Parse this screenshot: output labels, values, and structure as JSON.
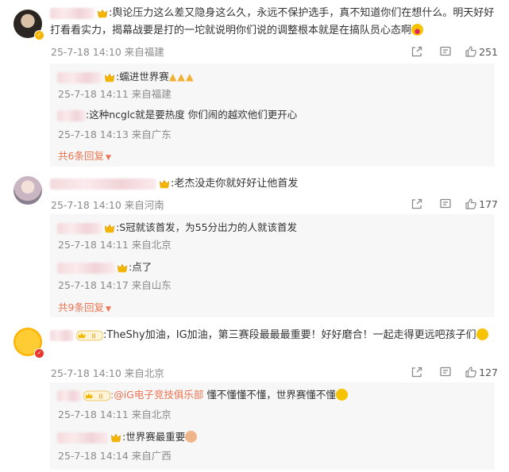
{
  "comments": [
    {
      "text": ":舆论压力这么差又隐身这么久，永远不保护选手，真不知道你们在想什么。明天好好打看看实力，揭幕战要是打的一坨就说明你们说的调整根本就是在搞队员心态啊",
      "time": "25-7-18 14:10",
      "location": "来自福建",
      "likes": "251",
      "replies": [
        {
          "text": ":蠕进世界赛",
          "time": "25-7-18 14:11",
          "location": "来自福建"
        },
        {
          "text": ":这种ncglc就是要热度 你们闹的越欢他们更开心",
          "time": "25-7-18 14:13",
          "location": "来自广东"
        }
      ],
      "more": "共6条回复"
    },
    {
      "text": ":老杰没走你就好好让他首发",
      "time": "25-7-18 14:10",
      "location": "来自河南",
      "likes": "177",
      "replies": [
        {
          "text": ":S冠就该首发，为55分出力的人就该首发",
          "time": "25-7-18 14:11",
          "location": "来自北京"
        },
        {
          "text": ":点了",
          "time": "25-7-18 14:17",
          "location": "来自山东"
        }
      ],
      "more": "共9条回复"
    },
    {
      "text": ":TheShy加油，IG加油，第三赛段最最最重要！好好磨合！一起走得更远吧孩子们",
      "time": "25-7-18 14:10",
      "location": "来自北京",
      "likes": "127",
      "replies": [
        {
          "mention": ":@iG电子竞技俱乐部",
          "text": "懂不懂懂不懂，世界赛懂不懂",
          "time": "25-7-18 14:11",
          "location": "来自北京"
        },
        {
          "text": ":世界赛最重要",
          "time": "25-7-18 14:14",
          "location": "来自广西"
        }
      ]
    }
  ],
  "colors": {
    "accent": "#eb7350",
    "meta": "#8a8a8a",
    "reply_bg": "#f7f7f7"
  },
  "icons": [
    "share-icon",
    "comment-icon",
    "like-icon",
    "crown-icon",
    "dropdown-arrow-icon"
  ]
}
